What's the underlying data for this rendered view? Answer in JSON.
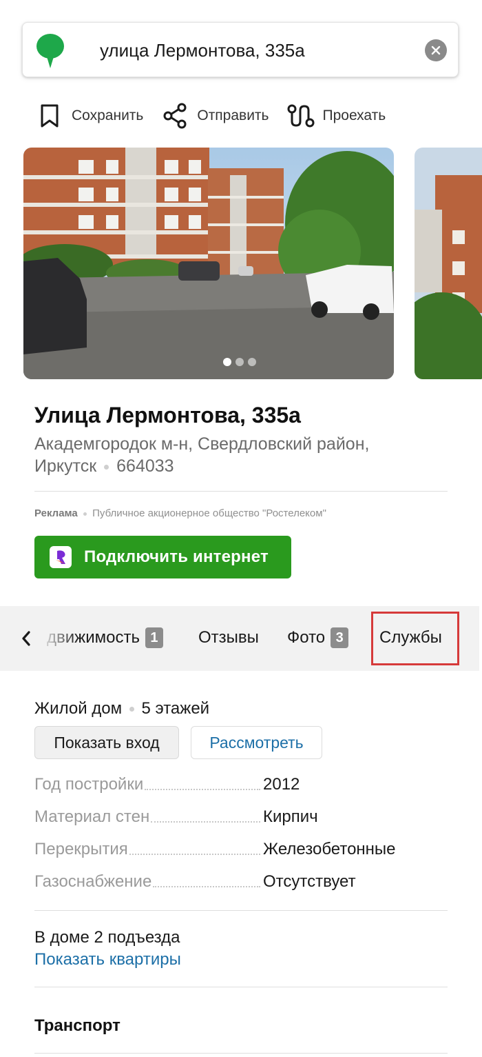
{
  "search": {
    "query": "улица Лермонтова, 335а",
    "logo_icon": "pin-logo-icon",
    "clear_icon": "clear-icon"
  },
  "actions": [
    {
      "label": "Сохранить",
      "icon": "bookmark-icon"
    },
    {
      "label": "Отправить",
      "icon": "share-icon"
    },
    {
      "label": "Проехать",
      "icon": "route-icon"
    }
  ],
  "gallery": {
    "photo_count_visible": 2,
    "pagination_dots": 3,
    "active_dot": 1
  },
  "place": {
    "title": "Улица Лермонтова, 335а",
    "address_line1": "Академгородок м-н, Свердловский район,",
    "city": "Иркутск",
    "postcode": "664033"
  },
  "ad": {
    "label": "Реклама",
    "advertiser": "Публичное акционерное общество \"Ростелеком\"",
    "cta_label": "Подключить интернет"
  },
  "tabs": [
    {
      "label": "движимость",
      "count": "1"
    },
    {
      "label": "Отзывы",
      "count": ""
    },
    {
      "label": "Фото",
      "count": "3"
    },
    {
      "label": "Службы",
      "count": ""
    }
  ],
  "building": {
    "kind": "Жилой дом",
    "floors": "5 этажей",
    "show_entrance": "Показать вход",
    "view": "Рассмотреть",
    "props": [
      {
        "key": "Год постройки",
        "value": "2012"
      },
      {
        "key": "Материал стен",
        "value": "Кирпич"
      },
      {
        "key": "Перекрытия",
        "value": "Железобетонные"
      },
      {
        "key": "Газоснабжение",
        "value": "Отсутствует"
      }
    ],
    "entrances": "В доме 2 подъезда",
    "show_apartments": "Показать квартиры"
  },
  "transport": {
    "heading": "Транспорт"
  },
  "colors": {
    "brand_green": "#2a9a1e",
    "link_blue": "#1c6fa7",
    "highlight_red": "#d63a3a",
    "logo_green": "#1ea84a"
  }
}
